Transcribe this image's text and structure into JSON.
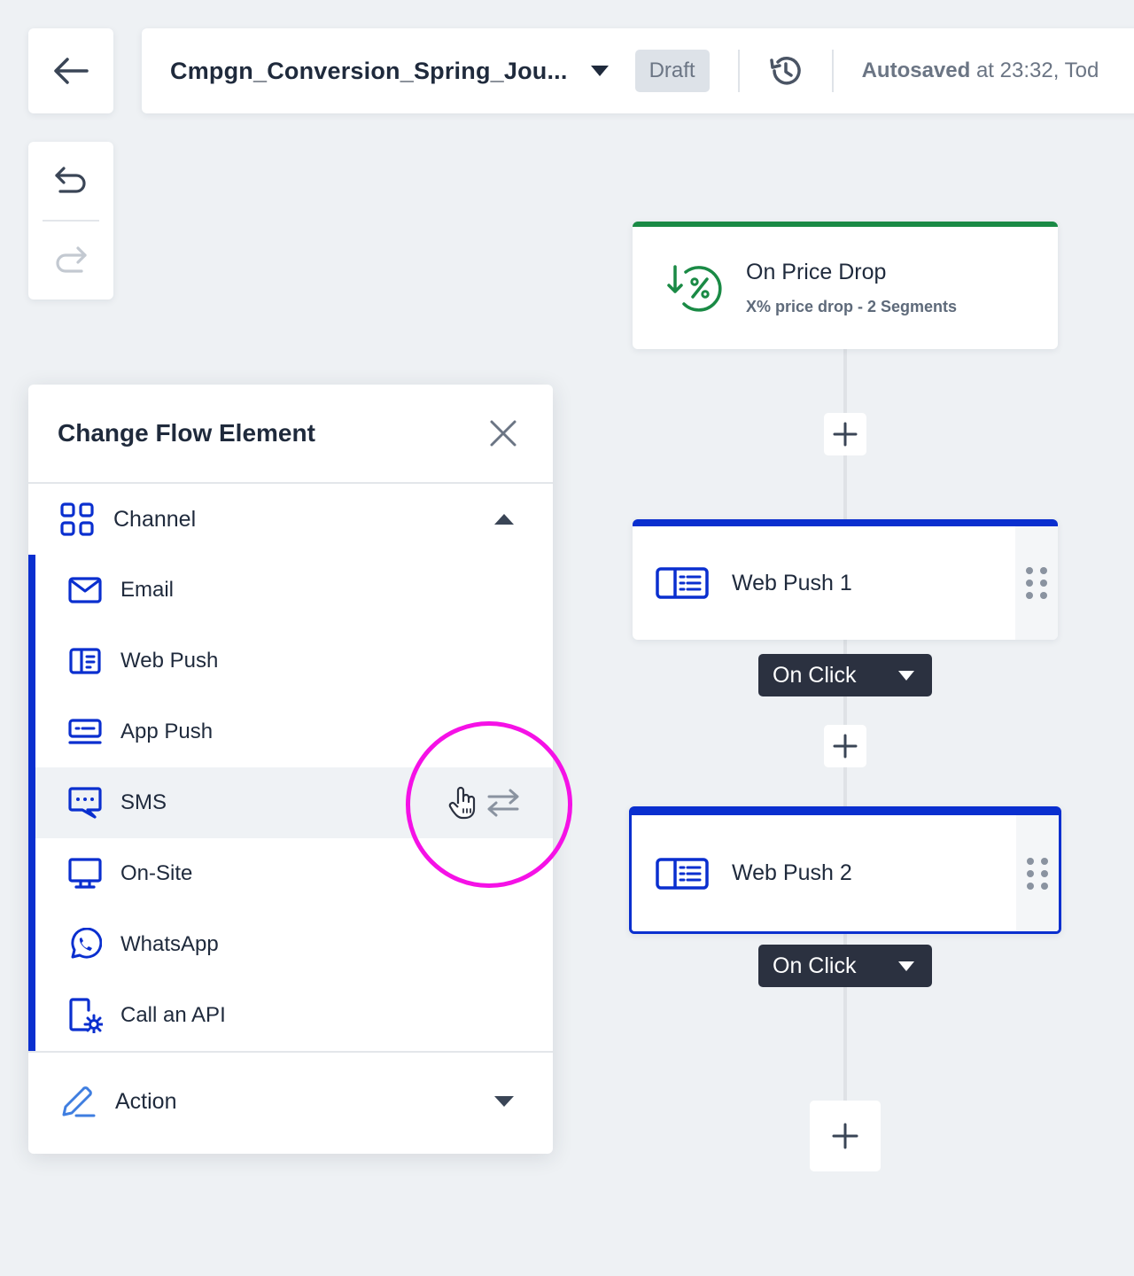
{
  "header": {
    "campaign_name": "Cmpgn_Conversion_Spring_Jou...",
    "status_badge": "Draft",
    "autosaved_label": "Autosaved",
    "autosaved_detail": " at 23:32, Tod"
  },
  "panel": {
    "title": "Change Flow Element",
    "channel_section": "Channel",
    "action_section": "Action",
    "channels": [
      {
        "label": "Email",
        "icon": "email-icon"
      },
      {
        "label": "Web Push",
        "icon": "web-push-icon"
      },
      {
        "label": "App Push",
        "icon": "app-push-icon"
      },
      {
        "label": "SMS",
        "icon": "sms-icon"
      },
      {
        "label": "On-Site",
        "icon": "on-site-icon"
      },
      {
        "label": "WhatsApp",
        "icon": "whatsapp-icon"
      },
      {
        "label": "Call an API",
        "icon": "api-icon"
      }
    ]
  },
  "flow": {
    "trigger": {
      "title": "On Price Drop",
      "subtitle": "X% price drop - 2 Segments"
    },
    "nodes": [
      {
        "label": "Web Push 1",
        "condition": "On Click"
      },
      {
        "label": "Web Push 2",
        "condition": "On Click"
      }
    ]
  },
  "colors": {
    "accent": "#0a2fcf",
    "trigger": "#1a8a45",
    "highlight": "#f511e6",
    "background": "#eef1f4"
  }
}
